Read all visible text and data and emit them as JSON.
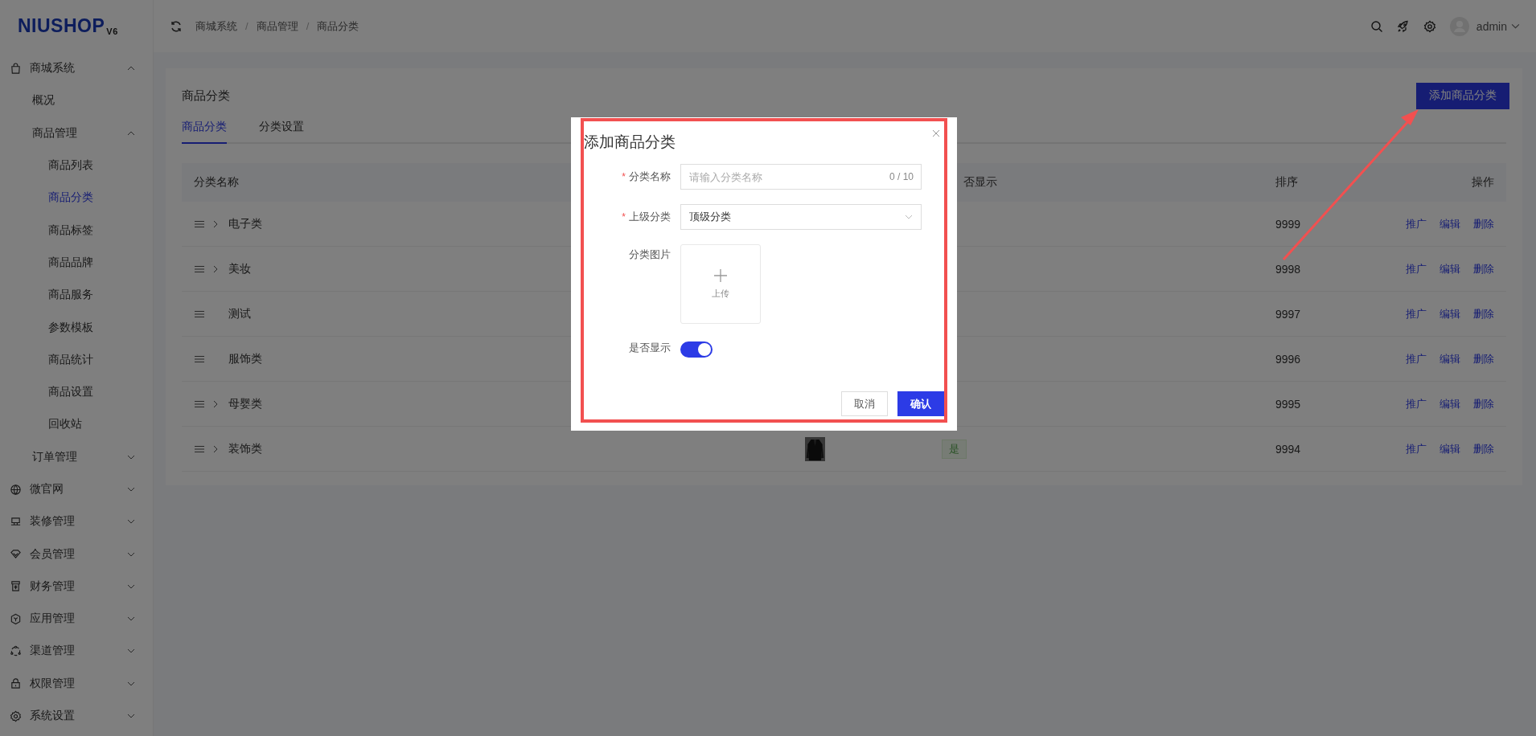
{
  "logo": {
    "name": "NIUSHOP",
    "version": "V6"
  },
  "breadcrumb": {
    "items": [
      "商城系统",
      "商品管理",
      "商品分类"
    ],
    "separators": [
      "/",
      "/"
    ]
  },
  "header": {
    "user": "admin"
  },
  "sidebar": {
    "items": [
      {
        "label": "商城系统",
        "selected": false,
        "expanded": true,
        "children": [
          {
            "label": "概况",
            "selected": false
          },
          {
            "label": "商品管理",
            "selected": false,
            "expanded": true,
            "children": [
              {
                "label": "商品列表",
                "selected": false
              },
              {
                "label": "商品分类",
                "selected": true
              },
              {
                "label": "商品标签",
                "selected": false
              },
              {
                "label": "商品品牌",
                "selected": false
              },
              {
                "label": "商品服务",
                "selected": false
              },
              {
                "label": "参数模板",
                "selected": false
              },
              {
                "label": "商品统计",
                "selected": false
              },
              {
                "label": "商品设置",
                "selected": false
              },
              {
                "label": "回收站",
                "selected": false
              }
            ]
          },
          {
            "label": "订单管理",
            "selected": false,
            "expanded": false
          }
        ]
      },
      {
        "label": "微官网",
        "selected": false,
        "expanded": false
      },
      {
        "label": "装修管理",
        "selected": false,
        "expanded": false
      },
      {
        "label": "会员管理",
        "selected": false,
        "expanded": false
      },
      {
        "label": "财务管理",
        "selected": false,
        "expanded": false
      },
      {
        "label": "应用管理",
        "selected": false,
        "expanded": false
      },
      {
        "label": "渠道管理",
        "selected": false,
        "expanded": false
      },
      {
        "label": "权限管理",
        "selected": false,
        "expanded": false
      },
      {
        "label": "系统设置",
        "selected": false,
        "expanded": false
      }
    ]
  },
  "page": {
    "title": "商品分类",
    "add_button": "添加商品分类",
    "tabs": [
      {
        "label": "商品分类",
        "selected": true
      },
      {
        "label": "分类设置",
        "selected": false
      }
    ]
  },
  "table": {
    "columns": [
      "分类名称",
      "否显示",
      "排序",
      "操作"
    ],
    "rows": [
      {
        "name": "电子类",
        "expandable": true,
        "sort": "9999",
        "actions": [
          "推广",
          "编辑",
          "删除"
        ]
      },
      {
        "name": "美妆",
        "expandable": true,
        "sort": "9998",
        "actions": [
          "推广",
          "编辑",
          "删除"
        ]
      },
      {
        "name": "测试",
        "expandable": false,
        "sort": "9997",
        "actions": [
          "推广",
          "编辑",
          "删除"
        ]
      },
      {
        "name": "服饰类",
        "expandable": false,
        "sort": "9996",
        "actions": [
          "推广",
          "编辑",
          "删除"
        ]
      },
      {
        "name": "母婴类",
        "expandable": true,
        "sort": "9995",
        "actions": [
          "推广",
          "编辑",
          "删除"
        ]
      },
      {
        "name": "装饰类",
        "expandable": true,
        "image": {
          "kind": "picture"
        },
        "show": "是",
        "sort": "9994",
        "actions": [
          "推广",
          "编辑",
          "删除"
        ]
      }
    ]
  },
  "dialog": {
    "title": "添加商品分类",
    "fields": [
      {
        "kind": "input",
        "label": "分类名称",
        "required_mark": "*",
        "placeholder": "请输入分类名称",
        "counter": "0 / 10"
      },
      {
        "kind": "select",
        "label": "上级分类",
        "required_mark": "*",
        "value": "顶级分类"
      },
      {
        "kind": "upload",
        "label": "分类图片",
        "button": "上传"
      },
      {
        "kind": "switch",
        "label": "是否显示",
        "on": true
      }
    ],
    "buttons": [
      {
        "label": "取消",
        "primary": false
      },
      {
        "label": "确认",
        "primary": true
      }
    ]
  }
}
